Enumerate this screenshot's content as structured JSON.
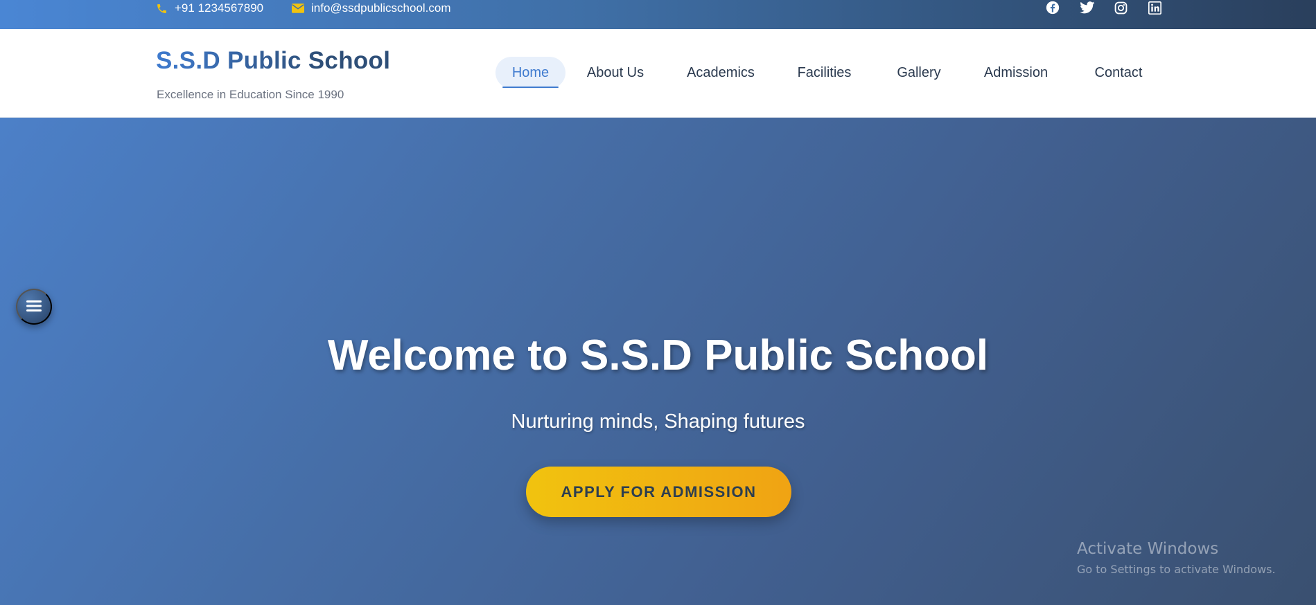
{
  "topbar": {
    "phone": "+91 1234567890",
    "email": "info@ssdpublicschool.com",
    "icons": [
      "phone-icon",
      "envelope-icon",
      "facebook-icon",
      "twitter-icon",
      "instagram-icon",
      "linkedin-icon"
    ],
    "accent_color": "#f1c30f"
  },
  "header": {
    "title": "S.S.D Public School",
    "tagline": "Excellence in Education Since 1990"
  },
  "nav": {
    "items": [
      {
        "label": "Home",
        "active": true
      },
      {
        "label": "About Us",
        "active": false
      },
      {
        "label": "Academics",
        "active": false
      },
      {
        "label": "Facilities",
        "active": false
      },
      {
        "label": "Gallery",
        "active": false
      },
      {
        "label": "Admission",
        "active": false
      },
      {
        "label": "Contact",
        "active": false
      }
    ],
    "active_color": "#3f7bcf"
  },
  "hero": {
    "title": "Welcome to S.S.D Public School",
    "subtitle": "Nurturing minds, Shaping futures",
    "cta_label": "APPLY FOR ADMISSION",
    "menu_icon": "hamburger-menu-icon"
  },
  "watermark": {
    "title": "Activate Windows",
    "subtitle": "Go to Settings to activate Windows."
  }
}
